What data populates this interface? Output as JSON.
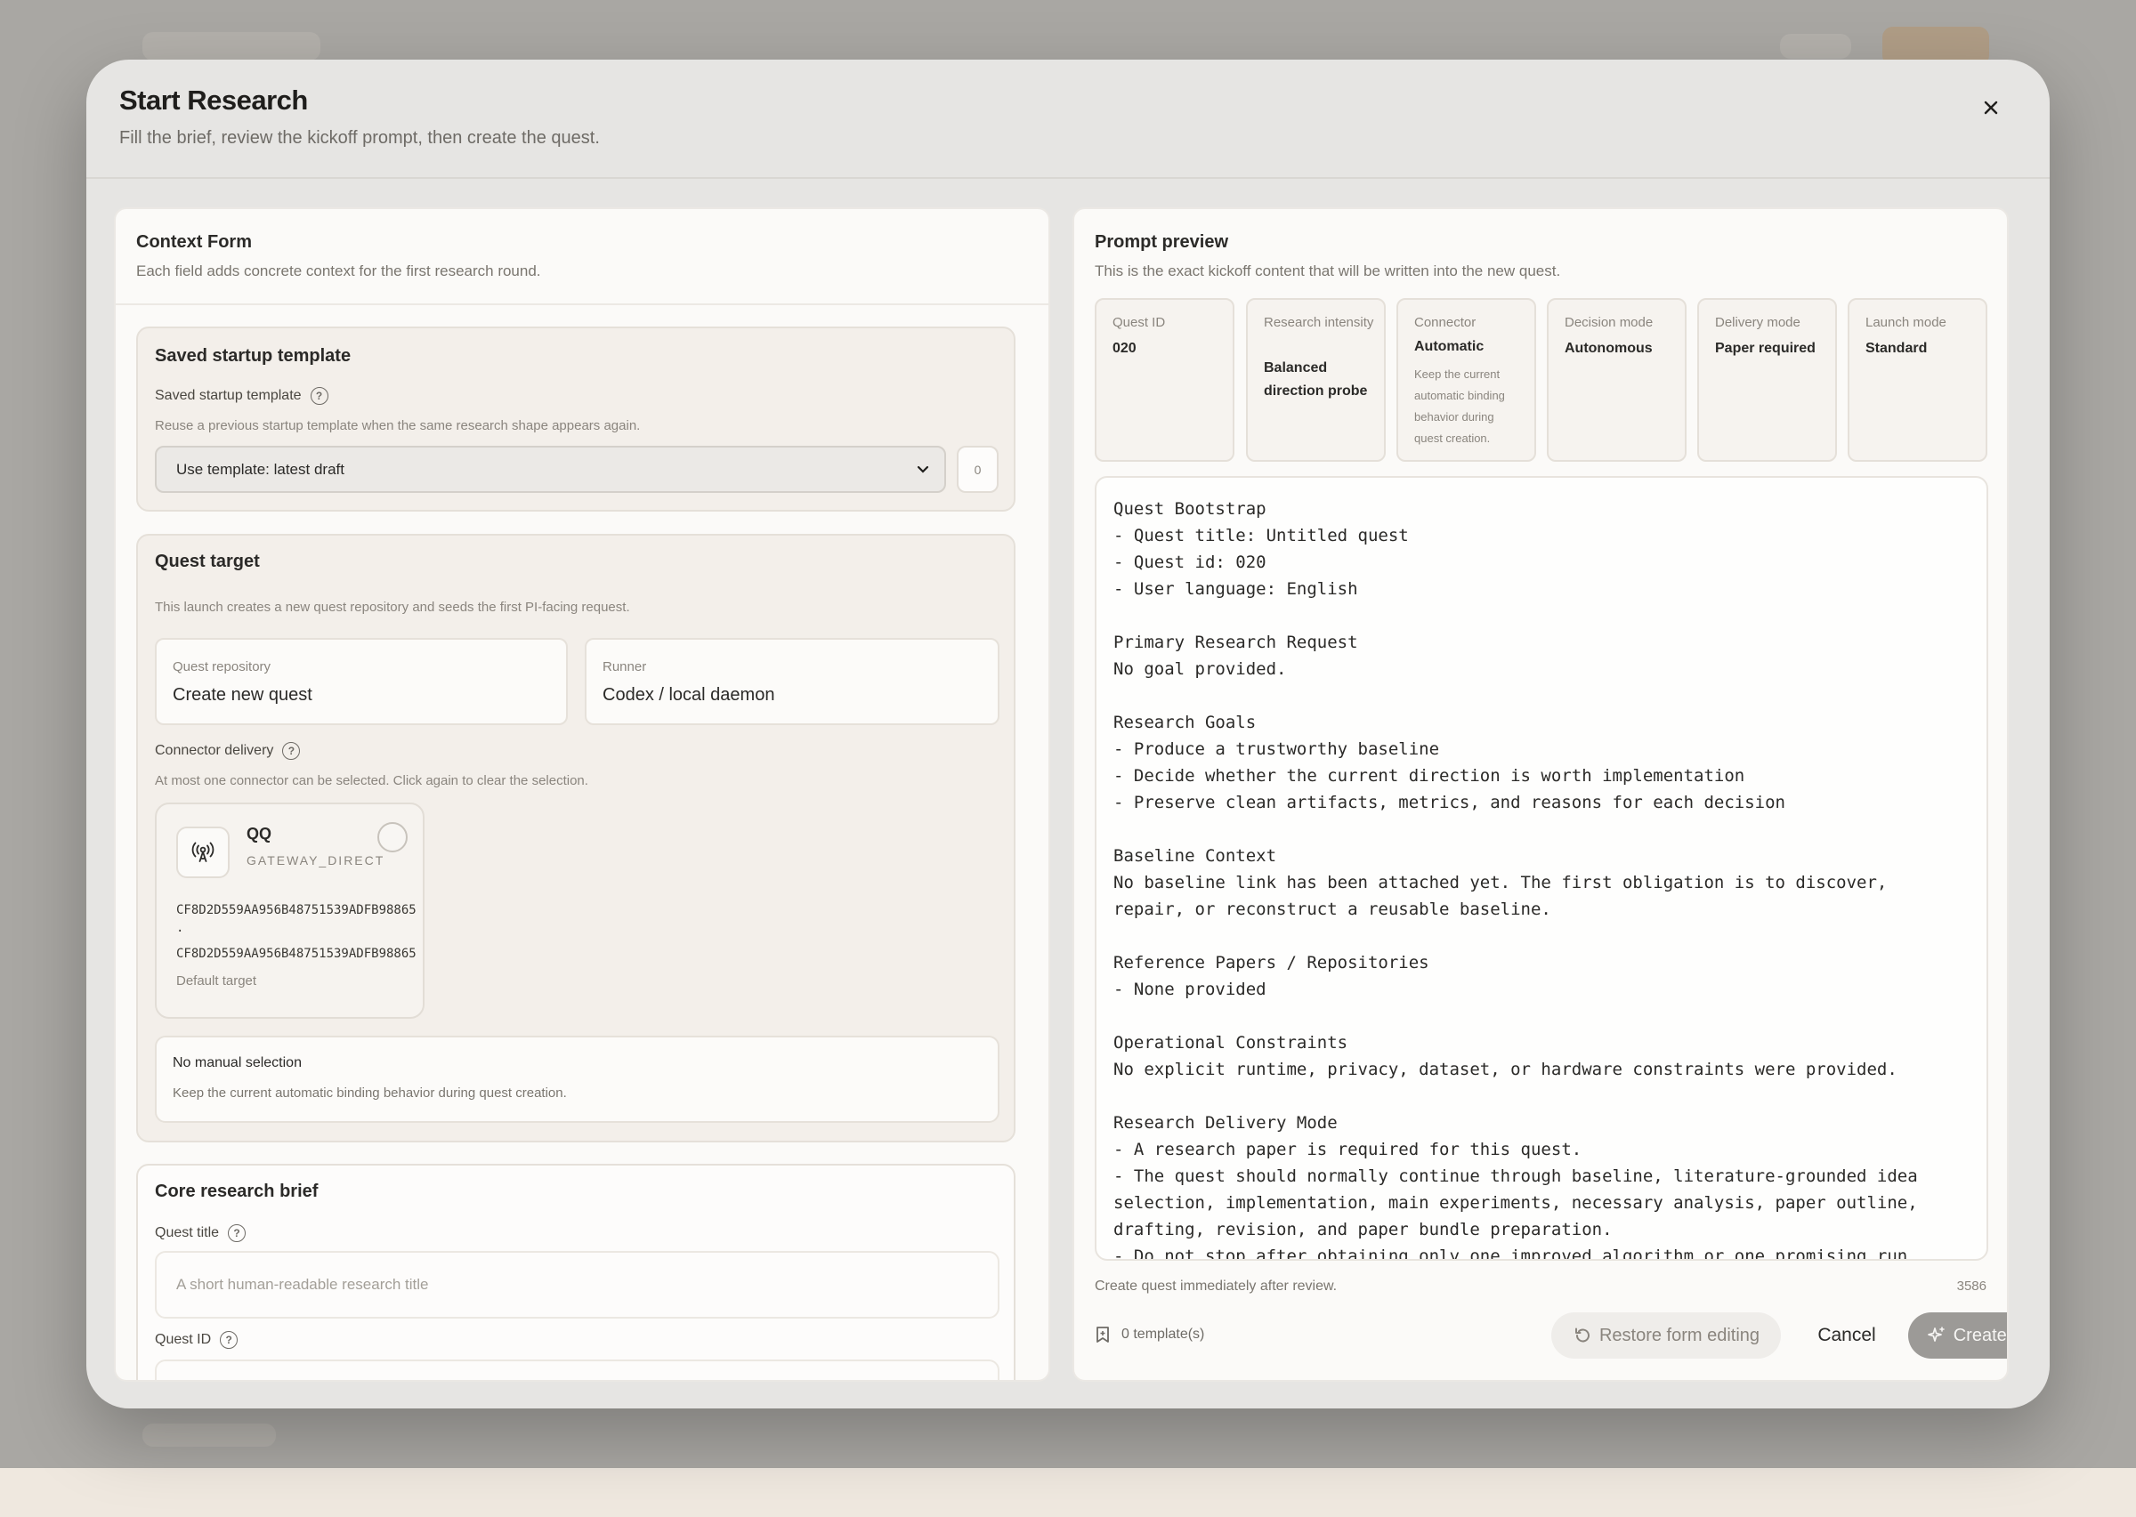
{
  "modal": {
    "title": "Start Research",
    "subtitle": "Fill the brief, review the kickoff prompt, then create the quest."
  },
  "context_form": {
    "title": "Context Form",
    "description": "Each field adds concrete context for the first research round.",
    "saved_template": {
      "title": "Saved startup template",
      "label": "Saved startup template",
      "hint": "Reuse a previous startup template when the same research shape appears again.",
      "selected": "Use template: latest draft",
      "count": "0"
    },
    "quest_target": {
      "title": "Quest target",
      "hint": "This launch creates a new quest repository and seeds the first PI-facing request.",
      "repository_label": "Quest repository",
      "repository_value": "Create new quest",
      "runner_label": "Runner",
      "runner_value": "Codex / local daemon",
      "connector_label": "Connector delivery",
      "connector_hint": "At most one connector can be selected. Click again to clear the selection.",
      "connector": {
        "name": "QQ",
        "type": "GATEWAY_DIRECT",
        "id_line1": "CF8D2D559AA956B48751539ADFB98865",
        "id_sep": ".",
        "id_line2": "CF8D2D559AA956B48751539ADFB98865",
        "default": "Default target"
      },
      "manual_title": "No manual selection",
      "manual_desc": "Keep the current automatic binding behavior during quest creation."
    },
    "core_brief": {
      "title": "Core research brief",
      "quest_title_label": "Quest title",
      "quest_title_placeholder": "A short human-readable research title",
      "quest_id_label": "Quest ID"
    }
  },
  "prompt_preview": {
    "title": "Prompt preview",
    "description": "This is the exact kickoff content that will be written into the new quest.",
    "meta": [
      {
        "label": "Quest ID",
        "value": "020",
        "extra": ""
      },
      {
        "label": "Research intensity",
        "value": "Balanced direction probe",
        "extra": ""
      },
      {
        "label": "Connector",
        "value": "Automatic",
        "extra": "Keep the current automatic binding behavior during quest creation."
      },
      {
        "label": "Decision mode",
        "value": "Autonomous",
        "extra": ""
      },
      {
        "label": "Delivery mode",
        "value": "Paper required",
        "extra": ""
      },
      {
        "label": "Launch mode",
        "value": "Standard",
        "extra": ""
      }
    ],
    "prompt": "Quest Bootstrap\n- Quest title: Untitled quest\n- Quest id: 020\n- User language: English\n\nPrimary Research Request\nNo goal provided.\n\nResearch Goals\n- Produce a trustworthy baseline\n- Decide whether the current direction is worth implementation\n- Preserve clean artifacts, metrics, and reasons for each decision\n\nBaseline Context\nNo baseline link has been attached yet. The first obligation is to discover, repair, or reconstruct a reusable baseline.\n\nReference Papers / Repositories\n- None provided\n\nOperational Constraints\nNo explicit runtime, privacy, dataset, or hardware constraints were provided.\n\nResearch Delivery Mode\n- A research paper is required for this quest.\n- The quest should normally continue through baseline, literature-grounded idea selection, implementation, main experiments, necessary analysis, paper outline, drafting, revision, and paper bundle preparation.\n- Do not stop after obtaining only one improved algorithm or one promising run.",
    "footer_note": "Create quest immediately after review.",
    "char_count": "3586",
    "template_count": "0 template(s)",
    "restore_label": "Restore form editing",
    "cancel_label": "Cancel",
    "create_label": "Create quest"
  }
}
